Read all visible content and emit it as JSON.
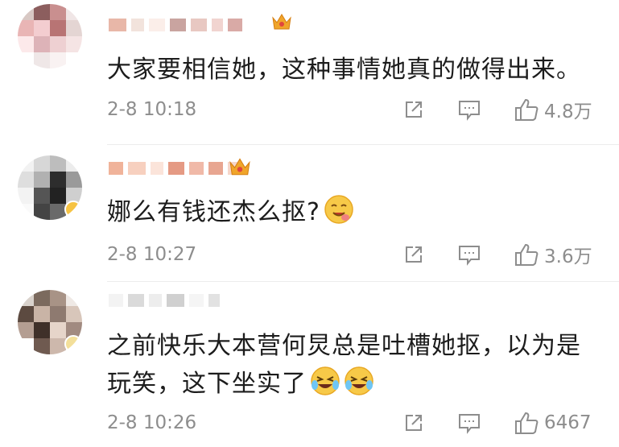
{
  "comments": [
    {
      "text_lines": [
        "大家要相信她，这种事情她真的做得出来。"
      ],
      "time": "2-8 10:18",
      "likes": "4.8万",
      "icons": [
        "share-icon",
        "comment-icon",
        "like-icon"
      ]
    },
    {
      "text_lines": [
        "娜么有钱还杰么抠?"
      ],
      "time": "2-8 10:27",
      "likes": "3.6万",
      "icons": [
        "share-icon",
        "comment-icon",
        "like-icon"
      ],
      "emojis": [
        "drooling-face-emoji"
      ]
    },
    {
      "text_lines": [
        "之前快乐大本营何炅总是吐槽她抠，以为是",
        "玩笑，这下坐实了"
      ],
      "time": "2-8 10:26",
      "likes": "6467",
      "icons": [
        "share-icon",
        "comment-icon",
        "like-icon"
      ],
      "emojis": [
        "laughing-crying-emoji",
        "laughing-crying-emoji"
      ]
    }
  ],
  "colors": {
    "meta_text": "#8d8d8d",
    "body_text": "#1c1c1c",
    "badge_gold": "#f6c343"
  }
}
